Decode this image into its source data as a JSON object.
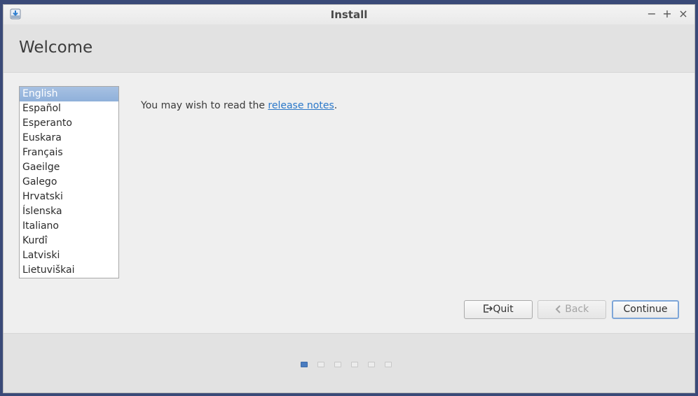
{
  "window": {
    "title": "Install",
    "controls": [
      "minimize",
      "maximize",
      "close"
    ]
  },
  "header": {
    "title": "Welcome"
  },
  "languages": {
    "selected": "English",
    "items": [
      "English",
      "Español",
      "Esperanto",
      "Euskara",
      "Français",
      "Gaeilge",
      "Galego",
      "Hrvatski",
      "Íslenska",
      "Italiano",
      "Kurdî",
      "Latviski",
      "Lietuviškai"
    ]
  },
  "main": {
    "notes_prefix": "You may wish to read the ",
    "notes_link": "release notes",
    "notes_suffix": "."
  },
  "buttons": {
    "quit": "Quit",
    "back": "Back",
    "continue": "Continue"
  },
  "progress": {
    "total_steps": 6,
    "current_step": 1
  },
  "colors": {
    "selection": "#9ab7de",
    "link": "#2b78c9",
    "active_step": "#4a7cc0"
  }
}
